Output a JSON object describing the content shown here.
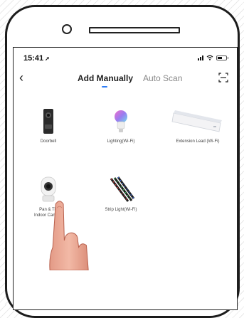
{
  "status_bar": {
    "time": "15:41",
    "location_glyph": "➚"
  },
  "nav": {
    "back_glyph": "‹",
    "tabs": [
      {
        "label": "Add Manually",
        "active": true
      },
      {
        "label": "Auto Scan",
        "active": false
      }
    ],
    "accent_color": "#2d7cf6"
  },
  "devices": [
    {
      "label": "Doorbell",
      "icon": "doorbell-icon"
    },
    {
      "label": "Lighting(Wi-Fi)",
      "icon": "bulb-icon"
    },
    {
      "label": "Extension Lead (Wi-Fi)",
      "icon": "extension-lead-icon"
    },
    {
      "label": "Pan & Tilt",
      "label2": "Indoor Camera",
      "icon": "camera-icon"
    },
    {
      "label": "Strip Light(Wi-Fi)",
      "icon": "strip-light-icon"
    }
  ],
  "icons": {
    "signal": "signal-icon",
    "wifi": "wifi-icon",
    "battery": "battery-icon",
    "scan": "scan-icon",
    "hand": "pointing-hand-icon"
  }
}
